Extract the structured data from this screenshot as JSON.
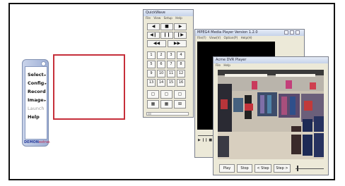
{
  "launcher": {
    "menu": [
      {
        "label": "Select",
        "arrow": "▸",
        "enabled": true
      },
      {
        "label": "Config",
        "arrow": "▸",
        "enabled": true
      },
      {
        "label": "Record",
        "arrow": "",
        "enabled": true
      },
      {
        "label": "Image",
        "arrow": "▸",
        "enabled": true
      },
      {
        "label": "Launch",
        "arrow": "",
        "enabled": false
      },
      {
        "label": "Help",
        "arrow": "",
        "enabled": true
      }
    ],
    "brand_part1": "DEMON",
    "brand_part2": "extras"
  },
  "quickwave": {
    "title": "QuickWave",
    "menu": [
      "File",
      "View",
      "Setup",
      "Help"
    ],
    "transport": [
      "◀",
      "■",
      "▶",
      "◀❙",
      "❙❙",
      "❙▶",
      "◀◀",
      "▶▶"
    ],
    "numbers": [
      "1",
      "2",
      "3",
      "4",
      "5",
      "6",
      "7",
      "8",
      "9",
      "10",
      "11",
      "12",
      "13",
      "14",
      "15",
      "16"
    ],
    "layout_buttons": [
      "▢",
      "▢",
      "▢",
      "▦",
      "▦",
      "⊞"
    ]
  },
  "mpeg4": {
    "title": "MPEG4 Media Player Version 1.2.0",
    "menu": [
      "File(F)",
      "View(V)",
      "Option(P)",
      "Help(H)"
    ],
    "controls": "▶ ❙❙ ■ ◀"
  },
  "acme": {
    "title": "Acme DVR Player",
    "menu": [
      "File",
      "Help"
    ],
    "buttons": {
      "play": "Play",
      "stop": "Stop",
      "step_back": "< Step",
      "step_fwd": "Step >"
    }
  }
}
